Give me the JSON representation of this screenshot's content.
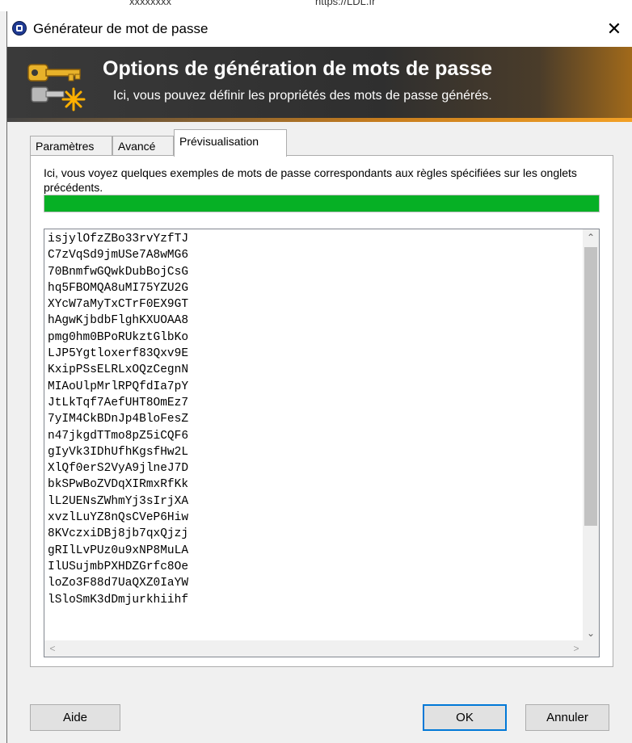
{
  "background_window": {
    "text1": "xxxxxxxx",
    "text2": "https://LDL.fr"
  },
  "titlebar": {
    "title": "Générateur de mot de passe",
    "close_glyph": "✕"
  },
  "banner": {
    "title": "Options de génération de mots de passe",
    "subtitle": "Ici, vous pouvez définir les propriétés des mots de passe générés."
  },
  "tabs": [
    {
      "label": "Paramètres",
      "active": false
    },
    {
      "label": "Avancé",
      "active": false
    },
    {
      "label": "Prévisualisation",
      "active": true
    }
  ],
  "preview": {
    "description": "Ici, vous voyez quelques exemples de mots de passe correspondants aux règles spécifiées sur les onglets précédents.",
    "progress_fraction": 1.0,
    "progress_color": "#06b025",
    "passwords": [
      "isjylOfzZBo33rvYzfTJ",
      "C7zVqSd9jmUSe7A8wMG6",
      "70BnmfwGQwkDubBojCsG",
      "hq5FBOMQA8uMI75YZU2G",
      "XYcW7aMyTxCTrF0EX9GT",
      "hAgwKjbdbFlghKXUOAA8",
      "pmg0hm0BPoRUkztGlbKo",
      "LJP5Ygtloxerf83Qxv9E",
      "KxipPSsELRLxOQzCegnN",
      "MIAoUlpMrlRPQfdIa7pY",
      "JtLkTqf7AefUHT8OmEz7",
      "7yIM4CkBDnJp4BloFesZ",
      "n47jkgdTTmo8pZ5iCQF6",
      "gIyVk3IDhUfhKgsfHw2L",
      "XlQf0erS2VyA9jlneJ7D",
      "bkSPwBoZVDqXIRmxRfKk",
      "lL2UENsZWhmYj3sIrjXA",
      "xvzlLuYZ8nQsCVeP6Hiw",
      "8KVczxiDBj8jb7qxQjzj",
      "gRIlLvPUz0u9xNP8MuLA",
      "IlUSujmbPXHDZGrfc8Oe",
      "loZo3F88d7UaQXZ0IaYW",
      "lSloSmK3dDmjurkhiihf"
    ]
  },
  "scrollbar": {
    "up": "⌃",
    "down": "⌄",
    "left": "<",
    "right": ">"
  },
  "buttons": {
    "help": "Aide",
    "ok": "OK",
    "cancel": "Annuler"
  },
  "icons": {
    "window_icon": "keepass-lock-icon",
    "banner_icon": "key-generate-icon"
  }
}
